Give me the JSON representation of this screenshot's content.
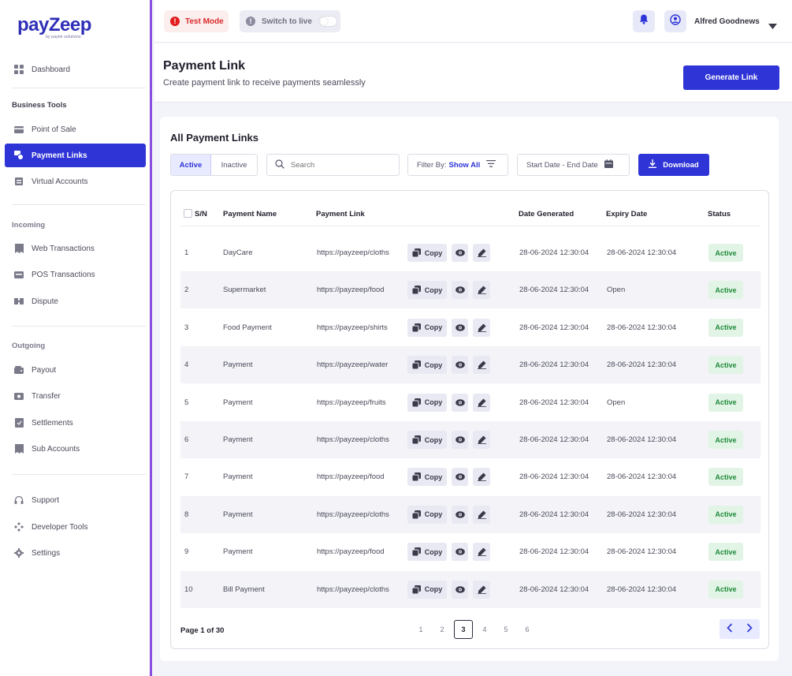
{
  "brand": {
    "logo_text": "payZeep",
    "tagline": "by paymi solutions"
  },
  "sidebar": {
    "dashboard": "Dashboard",
    "sections": [
      {
        "label": "Business Tools",
        "items": [
          "Point of Sale",
          "Payment Links",
          "Virtual Accounts"
        ]
      },
      {
        "label": "Incoming",
        "items": [
          "Web Transactions",
          "POS Transactions",
          "Dispute"
        ]
      },
      {
        "label": "Outgoing",
        "items": [
          "Payout",
          "Transfer",
          "Settlements",
          "Sub Accounts"
        ]
      }
    ],
    "bottom_items": [
      "Support",
      "Developer Tools",
      "Settings"
    ],
    "active_item": "Payment Links"
  },
  "topbar": {
    "test_mode": "Test Mode",
    "switch_live": "Switch to live",
    "user_name": "Alfred Goodnews"
  },
  "header": {
    "title": "Payment Link",
    "subtitle": "Create payment link to receive payments seamlessly",
    "generate_button": "Generate Link"
  },
  "card": {
    "title": "All Payment Links",
    "tabs": {
      "active": "Active",
      "inactive": "Inactive"
    },
    "search_placeholder": "Search",
    "filter_label": "Filter By:",
    "filter_value": "Show All",
    "date_range": "Start Date - End Date",
    "download": "Download"
  },
  "table": {
    "columns": [
      "S/N",
      "Payment Name",
      "Payment Link",
      "Date Generated",
      "Expiry Date",
      "Status"
    ],
    "copy_label": "Copy",
    "rows": [
      {
        "sn": "1",
        "name": "DayCare",
        "link": "https://payzeep/cloths",
        "generated": "28-06-2024 12:30:04",
        "expiry": "28-06-2024 12:30:04",
        "status": "Active"
      },
      {
        "sn": "2",
        "name": "Supermarket",
        "link": "https://payzeep/food",
        "generated": "28-06-2024 12:30:04",
        "expiry": "Open",
        "status": "Active"
      },
      {
        "sn": "3",
        "name": "Food Payment",
        "link": "https://payzeep/shirts",
        "generated": "28-06-2024 12:30:04",
        "expiry": "28-06-2024 12:30:04",
        "status": "Active"
      },
      {
        "sn": "4",
        "name": "Payment",
        "link": "https://payzeep/water",
        "generated": "28-06-2024 12:30:04",
        "expiry": "28-06-2024 12:30:04",
        "status": "Active"
      },
      {
        "sn": "5",
        "name": "Payment",
        "link": "https://payzeep/fruits",
        "generated": "28-06-2024 12:30:04",
        "expiry": "Open",
        "status": "Active"
      },
      {
        "sn": "6",
        "name": "Payment",
        "link": "https://payzeep/cloths",
        "generated": "28-06-2024 12:30:04",
        "expiry": "28-06-2024 12:30:04",
        "status": "Active"
      },
      {
        "sn": "7",
        "name": "Payment",
        "link": "https://payzeep/food",
        "generated": "28-06-2024 12:30:04",
        "expiry": "28-06-2024 12:30:04",
        "status": "Active"
      },
      {
        "sn": "8",
        "name": "Payment",
        "link": "https://payzeep/cloths",
        "generated": "28-06-2024 12:30:04",
        "expiry": "28-06-2024 12:30:04",
        "status": "Active"
      },
      {
        "sn": "9",
        "name": "Payment",
        "link": "https://payzeep/food",
        "generated": "28-06-2024 12:30:04",
        "expiry": "28-06-2024 12:30:04",
        "status": "Active"
      },
      {
        "sn": "10",
        "name": "Bill Payment",
        "link": "https://payzeep/cloths",
        "generated": "28-06-2024 12:30:04",
        "expiry": "28-06-2024 12:30:04",
        "status": "Active"
      }
    ]
  },
  "pagination": {
    "label": "Page 1 of 30",
    "pages": [
      "1",
      "2",
      "3",
      "4",
      "5",
      "6"
    ],
    "current": "3"
  },
  "colors": {
    "primary": "#2e34d6",
    "accent_border": "#8a4fe0",
    "status_green": "#1f8a3a",
    "test_red": "#e11d1d"
  }
}
